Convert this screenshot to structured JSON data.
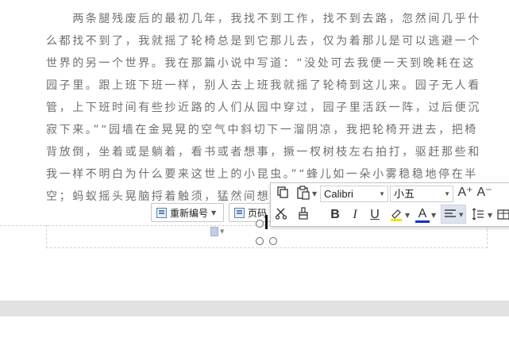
{
  "document": {
    "paragraph": "　　两条腿残废后的最初几年，我找不到工作，找不到去路，忽然间几乎什么都找不到了，我就摇了轮椅总是到它那儿去，仅为着那儿是可以逃避一个世界的另一个世界。我在那篇小说中写道：“没处可去我便一天到晚耗在这园子里。跟上班下班一样，别人去上班我就摇了轮椅到这儿来。园子无人看管，上下班时间有些抄近路的人们从园中穿过，园子里活跃一阵，过后便沉寂下来。”“园墙在金晃晃的空气中斜切下一溜阴凉，我把轮椅开进去，把椅背放倒，坐着或是躺着，看书或者想事，撅一杈树枝左右拍打，驱赶那些和我一样不明白为什么要来这世上的小昆虫。”“蜂儿如一朵小雾稳稳地停在半空；蚂蚁摇头晃脑捋着触须，猛然间想透了什么，转身疾行而去"
  },
  "footer_tools": {
    "renumber_label": "重新编号",
    "page_number_label": "页码"
  },
  "toolbar": {
    "font_name": "Calibri",
    "font_size": "小五",
    "bold": "B",
    "italic": "I",
    "underline": "U",
    "font_color_letter": "A",
    "grow_font": "A⁺",
    "shrink_font": "A⁻"
  },
  "colors": {
    "highlight": "#f2e400",
    "font_color": "#e03030"
  }
}
